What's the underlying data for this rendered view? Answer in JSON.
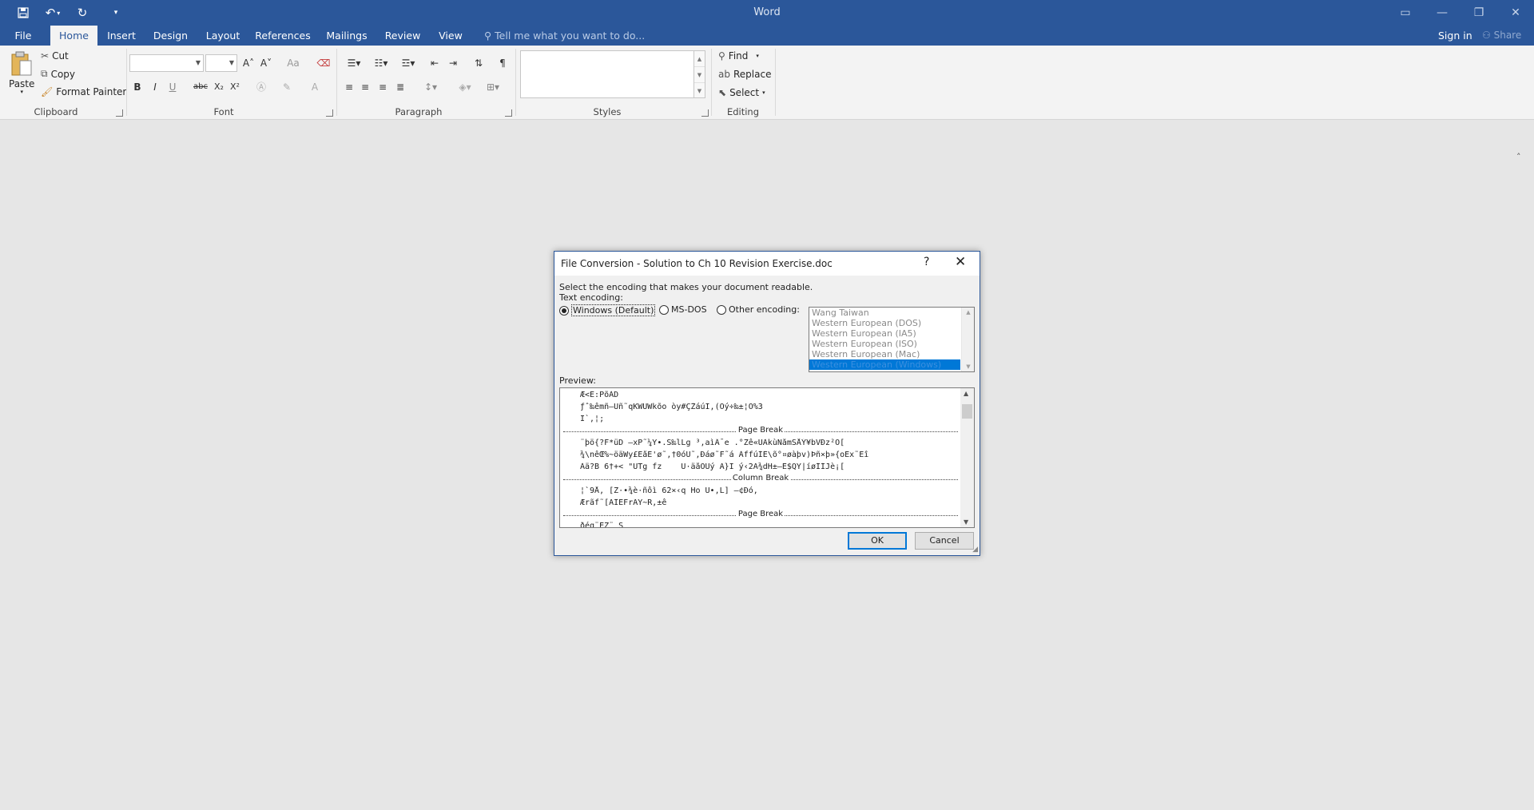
{
  "app": {
    "title": "Word"
  },
  "qat": {
    "save_icon": "save-icon",
    "undo_icon": "undo-icon",
    "redo_icon": "redo-icon",
    "customize_icon": "customize-icon"
  },
  "tabs": [
    "File",
    "Home",
    "Insert",
    "Design",
    "Layout",
    "References",
    "Mailings",
    "Review",
    "View"
  ],
  "tell_me": "Tell me what you want to do...",
  "account": {
    "sign_in": "Sign in",
    "share": "Share"
  },
  "ribbon": {
    "clipboard": {
      "paste": "Paste",
      "cut": "Cut",
      "copy": "Copy",
      "format_painter": "Format Painter",
      "label": "Clipboard"
    },
    "font": {
      "label": "Font",
      "bold": "B",
      "italic": "I",
      "underline": "U",
      "strike": "abc",
      "sub": "X₂",
      "sup": "X²",
      "grow": "A˄",
      "shrink": "A˅",
      "case": "Aa"
    },
    "paragraph": {
      "label": "Paragraph",
      "pilcrow": "¶"
    },
    "styles": {
      "label": "Styles"
    },
    "editing": {
      "label": "Editing",
      "find": "Find",
      "replace": "Replace",
      "select": "Select"
    }
  },
  "dialog": {
    "title": "File Conversion - Solution to Ch 10 Revision Exercise.doc",
    "help": "?",
    "close": "✕",
    "instruction": "Select the encoding that makes your document readable.",
    "text_encoding_label": "Text encoding:",
    "options": {
      "windows": "Windows (Default)",
      "msdos": "MS-DOS",
      "other": "Other encoding:"
    },
    "encodings": [
      "Wang Taiwan",
      "Western European (DOS)",
      "Western European (IA5)",
      "Western European (ISO)",
      "Western European (Mac)",
      "Western European (Windows)"
    ],
    "selected_encoding": "Western European (Windows)",
    "preview_label": "Preview:",
    "preview_lines": [
      "Æ<Ë:PõÀD",
      "ƒˆ‰êmñ–Ùñ˜qKWÜWkõo òy#ÇŽáúÏ,(Óý÷‰±¦Ó%3",
      "Ï`,¦;",
      "¨þö{?F*üD –xP˜¼Y•.Š‰lLg ³,aìÂ¯e .°Zê«ÜÀkùNåmSÅÝ¥bVÐz²Ó[",
      "¾\\nêŒ%~öäWy£EåE'ø˜,†0óÜ˜,Ðáø˜F˜á ÁffúÍÊ\\õ°¤øàþv)Þñ×þ»{oËx˜Ëî",
      "Àä?B 6†+< \"ÜTg fz    Ù·äåÒÜý Ä}I ý‹2A¾dH±–Ê$QŸ|íøÍÍJè¡[",
      "¦`9Å, [Z·•¾è·ñôì 62×‹q Ho Ü•,L] –¢Ðó,",
      "Ærãf˜[AÎËFrÃY~R,±ê",
      "ðéq¨ÉZ¨ Š"
    ],
    "page_break": "Page Break",
    "column_break": "Column Break",
    "ok": "OK",
    "cancel": "Cancel"
  }
}
